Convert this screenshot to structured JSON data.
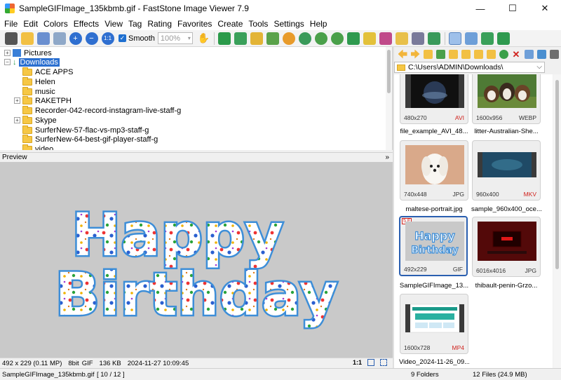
{
  "window": {
    "title": "SampleGIFImage_135kbmb.gif  -  FastStone Image Viewer 7.9",
    "minimize": "—",
    "maximize": "☐",
    "close": "✕"
  },
  "menu": [
    "File",
    "Edit",
    "Colors",
    "Effects",
    "View",
    "Tag",
    "Rating",
    "Favorites",
    "Create",
    "Tools",
    "Settings",
    "Help"
  ],
  "toolbar": {
    "smooth_label": "Smooth",
    "zoom_value": "100%"
  },
  "tree": {
    "items": [
      {
        "label": "Pictures",
        "level": 1
      },
      {
        "label": "Downloads",
        "level": 1,
        "selected": true
      },
      {
        "label": "ACE APPS",
        "level": 2
      },
      {
        "label": "Helen",
        "level": 2
      },
      {
        "label": "music",
        "level": 2
      },
      {
        "label": "RAKETPH",
        "level": 2
      },
      {
        "label": "Recorder-042-record-instagram-live-staff-g",
        "level": 2
      },
      {
        "label": "Skype",
        "level": 2
      },
      {
        "label": "SurferNew-57-flac-vs-mp3-staff-g",
        "level": 2
      },
      {
        "label": "SurferNew-64-best-gif-player-staff-g",
        "level": 2
      },
      {
        "label": "video",
        "level": 2
      }
    ]
  },
  "preview": {
    "header": "Preview",
    "image_text_line1": "Happy",
    "image_text_line2": "Birthday"
  },
  "info": {
    "dimensions": "492 x 229 (0.11 MP)",
    "bitdepth": "8bit",
    "format": "GIF",
    "size": "136 KB",
    "date": "2024-11-27 10:09:45",
    "ratio": "1:1"
  },
  "browser": {
    "path": "C:\\Users\\ADMIN\\Downloads\\",
    "thumbnails": [
      {
        "dims": "480x270",
        "fmt": "AVI",
        "name": "file_example_AVI_48...",
        "red": true
      },
      {
        "dims": "1600x956",
        "fmt": "WEBP",
        "name": "litter-Australian-She...",
        "red": false
      },
      {
        "dims": "740x448",
        "fmt": "JPG",
        "name": "maltese-portrait.jpg",
        "red": false
      },
      {
        "dims": "960x400",
        "fmt": "MKV",
        "name": "sample_960x400_oce...",
        "red": true
      },
      {
        "dims": "492x229",
        "fmt": "GIF",
        "name": "SampleGIFImage_13...",
        "red": false,
        "selected": true,
        "badge": "5 F"
      },
      {
        "dims": "6016x4016",
        "fmt": "JPG",
        "name": "thibault-penin-Grzo...",
        "red": false
      },
      {
        "dims": "1600x728",
        "fmt": "MP4",
        "name": "Video_2024-11-26_09...",
        "red": true
      }
    ]
  },
  "status": {
    "file": "SampleGIFImage_135kbmb.gif",
    "position": "[ 10 / 12 ]",
    "folders": "9 Folders",
    "files": "12 Files (24.9 MB)"
  }
}
